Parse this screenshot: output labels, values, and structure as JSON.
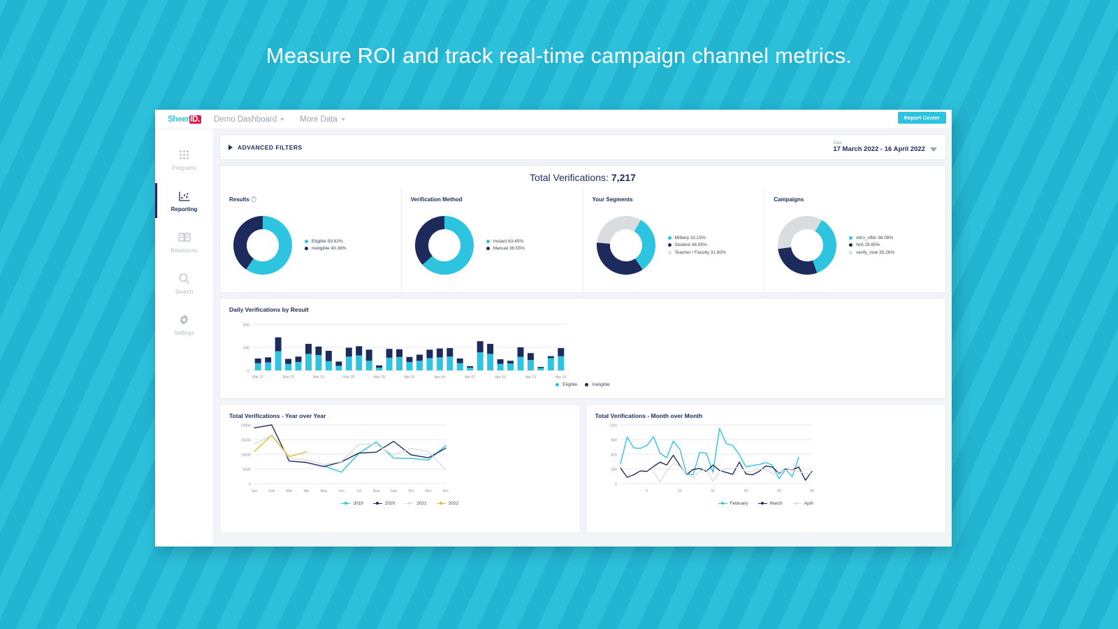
{
  "headline": "Measure ROI and track real-time campaign channel metrics.",
  "brand": {
    "name_part1": "Sheer",
    "name_part2": "ID.",
    "accent": "#2ec4e0",
    "red": "#e8174a"
  },
  "colors": {
    "cyan": "#2ec4e0",
    "navy": "#1d2b5c",
    "grey": "#d9dde0",
    "yellow": "#d9c02e"
  },
  "topbar": {
    "menus": [
      {
        "label": "Demo Dashboard"
      },
      {
        "label": "More Data"
      }
    ],
    "report_center": "Report Center"
  },
  "sidebar": {
    "items": [
      {
        "label": "Programs",
        "icon": "grid-icon",
        "active": false
      },
      {
        "label": "Reporting",
        "icon": "report-chart-icon",
        "active": true
      },
      {
        "label": "Resources",
        "icon": "book-icon",
        "active": false
      },
      {
        "label": "Search",
        "icon": "search-icon",
        "active": false
      },
      {
        "label": "Settings",
        "icon": "gear-icon",
        "active": false
      }
    ]
  },
  "filters": {
    "advanced_label": "ADVANCED FILTERS",
    "date_label": "Date",
    "date_value": "17 March 2022  -  16 April 2022"
  },
  "total": {
    "label": "Total Verifications:",
    "value": "7,217"
  },
  "chart_data": [
    {
      "type": "pie",
      "title": "Results",
      "has_help_icon": true,
      "labels": [
        "Eligible",
        "Ineligible"
      ],
      "values": [
        59.62,
        40.38
      ],
      "value_labels": [
        "Eligible 59.62%",
        "Ineligible 40.38%"
      ],
      "colors": [
        "#2ec4e0",
        "#1d2b5c"
      ],
      "legend": "right"
    },
    {
      "type": "pie",
      "title": "Verification Method",
      "has_help_icon": false,
      "labels": [
        "Instant",
        "Manual"
      ],
      "values": [
        63.45,
        36.55
      ],
      "value_labels": [
        "Instant 63.45%",
        "Manual 36.55%"
      ],
      "colors": [
        "#2ec4e0",
        "#1d2b5c"
      ],
      "legend": "right"
    },
    {
      "type": "pie",
      "title": "Your Segments",
      "has_help_icon": false,
      "labels": [
        "Military",
        "Student",
        "Teacher / Faculty"
      ],
      "values": [
        32.15,
        36.05,
        31.8
      ],
      "value_labels": [
        "Military 32.15%",
        "Student 36.05%",
        "Teacher / Faculty 31.80%"
      ],
      "colors": [
        "#2ec4e0",
        "#1d2b5c",
        "#d9dde0"
      ],
      "legend": "right"
    },
    {
      "type": "pie",
      "title": "Campaigns",
      "has_help_icon": false,
      "labels": [
        "intro_offer",
        "N/A",
        "verify_now"
      ],
      "values": [
        36.08,
        28.65,
        35.26
      ],
      "value_labels": [
        "intro_offer 36.08%",
        "N/A 28.65%",
        "verify_now 35.26%"
      ],
      "colors": [
        "#2ec4e0",
        "#1d2b5c",
        "#d9dde0"
      ],
      "legend": "right"
    },
    {
      "type": "bar",
      "stacked": true,
      "title": "Daily Verifications by Result",
      "xlabel": "",
      "ylabel": "",
      "ylim": [
        0,
        600
      ],
      "yticks": [
        0,
        300,
        600
      ],
      "ytick_labels": [
        "0",
        "300",
        "600"
      ],
      "grid": true,
      "legend": "bottom",
      "tick_labels": [
        "Mar 17",
        "Mar 20",
        "Mar 23",
        "Mar 26",
        "Mar 29",
        "Apr 01",
        "Apr 04",
        "Apr 07",
        "Apr 10",
        "Apr 13",
        "Apr 16"
      ],
      "categories": [
        "Mar 17",
        "Mar 18",
        "Mar 19",
        "Mar 20",
        "Mar 21",
        "Mar 22",
        "Mar 23",
        "Mar 24",
        "Mar 25",
        "Mar 26",
        "Mar 27",
        "Mar 28",
        "Mar 29",
        "Mar 30",
        "Mar 31",
        "Apr 01",
        "Apr 02",
        "Apr 03",
        "Apr 04",
        "Apr 05",
        "Apr 06",
        "Apr 07",
        "Apr 08",
        "Apr 09",
        "Apr 10",
        "Apr 11",
        "Apr 12",
        "Apr 13",
        "Apr 14",
        "Apr 15",
        "Apr 16"
      ],
      "series": [
        {
          "name": "Eligible",
          "color": "#2ec4e0",
          "values": [
            95,
            105,
            250,
            85,
            110,
            215,
            200,
            120,
            60,
            180,
            195,
            125,
            35,
            165,
            175,
            110,
            125,
            160,
            170,
            180,
            95,
            35,
            235,
            215,
            85,
            90,
            175,
            135,
            30,
            160,
            185
          ]
        },
        {
          "name": "Ineligible",
          "color": "#1d2b5c",
          "values": [
            60,
            65,
            180,
            65,
            70,
            130,
            110,
            135,
            55,
            115,
            120,
            145,
            30,
            115,
            100,
            65,
            80,
            110,
            115,
            110,
            60,
            20,
            145,
            130,
            60,
            35,
            125,
            90,
            15,
            25,
            105
          ]
        }
      ]
    },
    {
      "type": "line",
      "title": "Total Verifications - Year over Year",
      "xlabel": "",
      "ylabel": "",
      "ylim": [
        0,
        20000
      ],
      "yticks": [
        0,
        5000,
        10000,
        15000,
        20000
      ],
      "ytick_labels": [
        "0",
        "5000",
        "10000",
        "15000",
        "20000"
      ],
      "grid": true,
      "legend": "bottom",
      "x": [
        "Jan",
        "Feb",
        "Mar",
        "Apr",
        "May",
        "Jun",
        "Jul",
        "Aug",
        "Sep",
        "Oct",
        "Nov",
        "Dec"
      ],
      "series": [
        {
          "name": "2019",
          "color": "#2ec4e0",
          "values": [
            null,
            null,
            null,
            null,
            6000,
            3900,
            10300,
            14200,
            8700,
            8600,
            8000,
            13000
          ]
        },
        {
          "name": "2020",
          "color": "#1d2b5c",
          "values": [
            19000,
            20000,
            7700,
            7200,
            5800,
            7400,
            10400,
            10700,
            14400,
            9800,
            8800,
            12100
          ]
        },
        {
          "name": "2021",
          "color": "#d9dde0",
          "values": [
            13500,
            16400,
            8600,
            8000,
            6500,
            7500,
            13400,
            13400,
            9700,
            12000,
            11000,
            4700
          ]
        },
        {
          "name": "2022",
          "color": "#d9c02e",
          "values": [
            11000,
            16500,
            9200,
            10800,
            null,
            null,
            null,
            null,
            null,
            null,
            null,
            null
          ]
        }
      ]
    },
    {
      "type": "line",
      "title": "Total Verifications - Month over Month",
      "xlabel": "",
      "ylabel": "",
      "ylim": [
        0,
        1200
      ],
      "yticks": [
        0,
        300,
        600,
        900,
        1200
      ],
      "ytick_labels": [
        "0",
        "300",
        "600",
        "900",
        "1200"
      ],
      "xticks": [
        5,
        10,
        15,
        20,
        25,
        30
      ],
      "grid": true,
      "legend": "bottom",
      "x": [
        1,
        2,
        3,
        4,
        5,
        6,
        7,
        8,
        9,
        10,
        11,
        12,
        13,
        14,
        15,
        16,
        17,
        18,
        19,
        20,
        21,
        22,
        23,
        24,
        25,
        26,
        27,
        28,
        29,
        30
      ],
      "series": [
        {
          "name": "February",
          "color": "#2ec4e0",
          "values": [
            410,
            950,
            730,
            720,
            780,
            960,
            620,
            530,
            870,
            700,
            200,
            180,
            640,
            620,
            230,
            1130,
            820,
            780,
            590,
            340,
            370,
            390,
            430,
            380,
            100,
            290,
            140,
            540,
            null,
            null
          ]
        },
        {
          "name": "March",
          "color": "#1d2b5c",
          "values": [
            320,
            130,
            180,
            260,
            250,
            350,
            440,
            380,
            580,
            370,
            180,
            290,
            310,
            250,
            380,
            270,
            230,
            190,
            440,
            200,
            180,
            250,
            360,
            340,
            210,
            300,
            280,
            340,
            70,
            250
          ]
        },
        {
          "name": "April",
          "color": "#d9dde0",
          "values": [
            null,
            null,
            null,
            null,
            null,
            240,
            30,
            270,
            410,
            350,
            190,
            120,
            250,
            290,
            50,
            250,
            310,
            300,
            350,
            240,
            260,
            300,
            290,
            200,
            230,
            280,
            290,
            250,
            200,
            210
          ]
        }
      ]
    }
  ]
}
